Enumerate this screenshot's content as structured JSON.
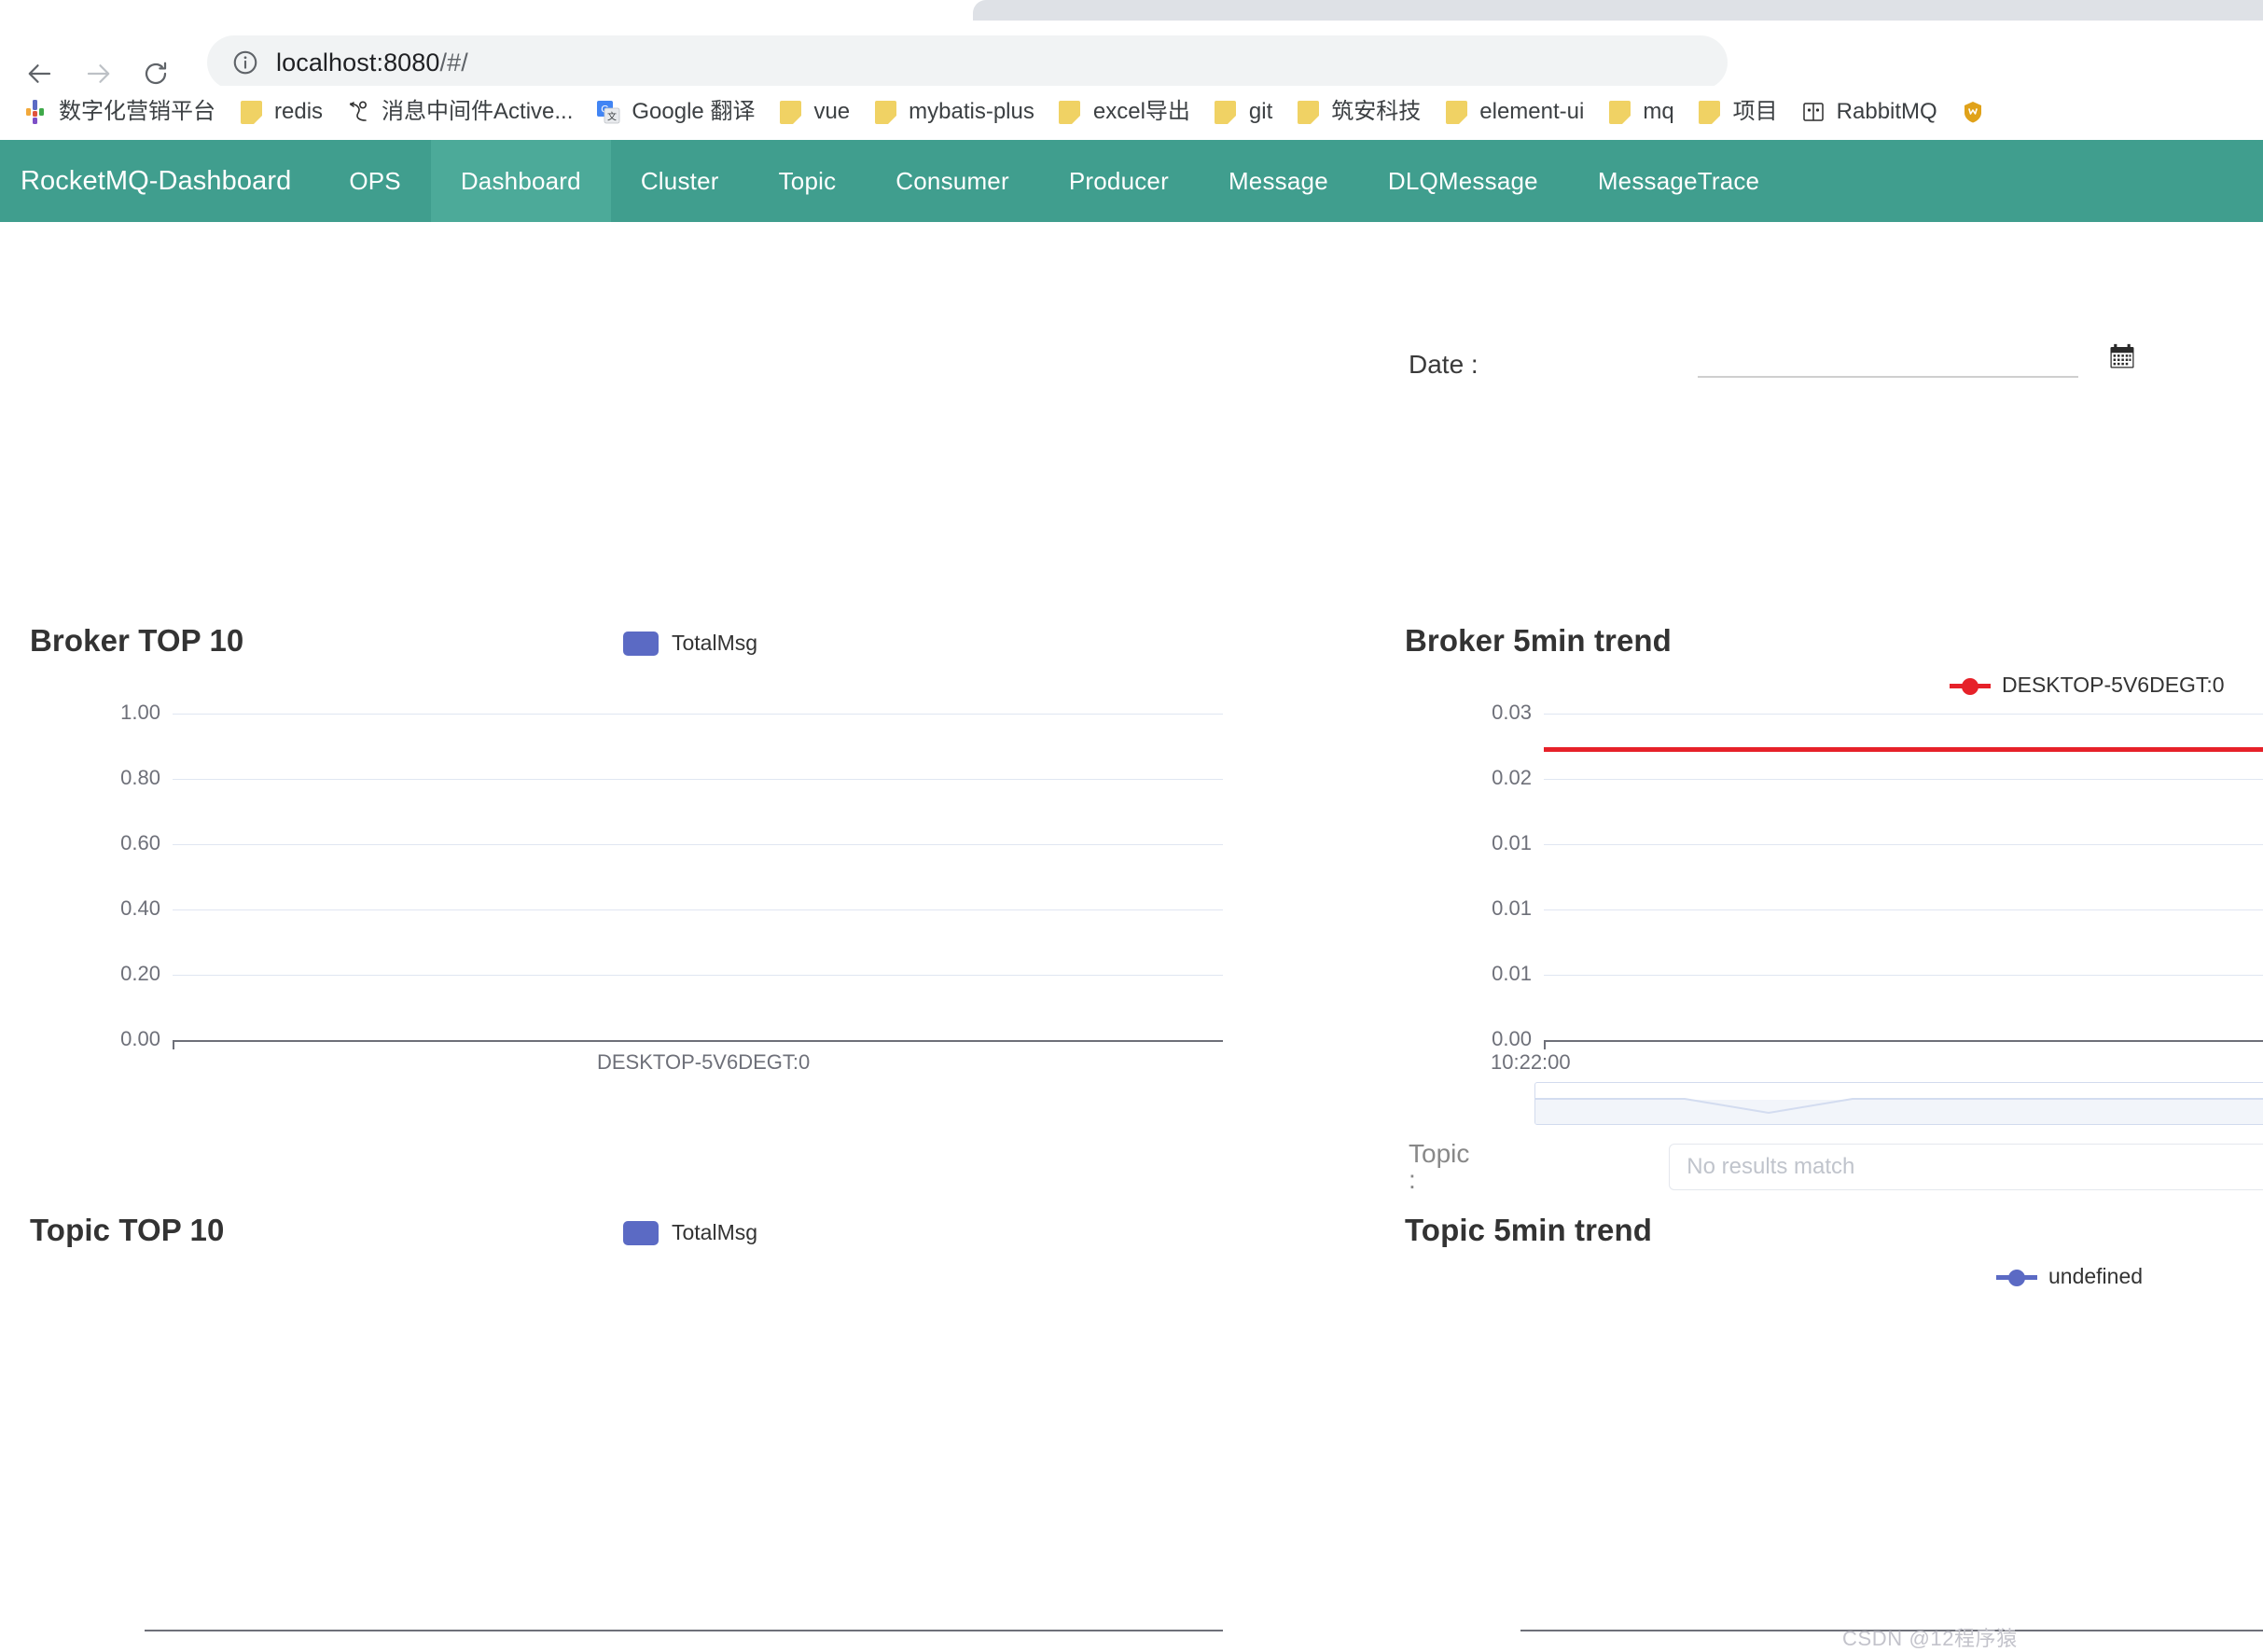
{
  "browser": {
    "url_host": "localhost:8080",
    "url_path": "/#/",
    "back_icon": "back-arrow-icon",
    "forward_icon": "forward-arrow-icon",
    "reload_icon": "reload-icon",
    "info_icon": "site-info-icon",
    "bookmarks": [
      {
        "label": "数字化营销平台",
        "icon": "app-logo-icon"
      },
      {
        "label": "redis",
        "icon": "folder-icon"
      },
      {
        "label": "消息中间件Active...",
        "icon": "activemq-icon"
      },
      {
        "label": "Google 翻译",
        "icon": "google-translate-icon"
      },
      {
        "label": "vue",
        "icon": "folder-icon"
      },
      {
        "label": "mybatis-plus",
        "icon": "folder-icon"
      },
      {
        "label": "excel导出",
        "icon": "folder-icon"
      },
      {
        "label": "git",
        "icon": "folder-icon"
      },
      {
        "label": "筑安科技",
        "icon": "folder-icon"
      },
      {
        "label": "element-ui",
        "icon": "folder-icon"
      },
      {
        "label": "mq",
        "icon": "folder-icon"
      },
      {
        "label": "项目",
        "icon": "folder-icon"
      },
      {
        "label": "RabbitMQ",
        "icon": "rabbitmq-icon"
      },
      {
        "label": "",
        "icon": "shield-bookmark-icon"
      }
    ]
  },
  "app": {
    "brand": "RocketMQ-Dashboard",
    "accent_color": "#409e8e",
    "accent_active_color": "#4caa99",
    "nav": [
      {
        "label": "OPS",
        "active": false
      },
      {
        "label": "Dashboard",
        "active": true
      },
      {
        "label": "Cluster",
        "active": false
      },
      {
        "label": "Topic",
        "active": false
      },
      {
        "label": "Consumer",
        "active": false
      },
      {
        "label": "Producer",
        "active": false
      },
      {
        "label": "Message",
        "active": false
      },
      {
        "label": "DLQMessage",
        "active": false
      },
      {
        "label": "MessageTrace",
        "active": false
      }
    ]
  },
  "filters": {
    "date_label": "Date :",
    "date_value": "",
    "date_placeholder": "",
    "calendar_icon": "calendar-icon",
    "topic_label": "Topic :",
    "topic_value": "",
    "topic_placeholder": "No results match"
  },
  "chart_data": [
    {
      "id": "broker-top-10",
      "type": "bar",
      "title": "Broker TOP 10",
      "legend": [
        "TotalMsg"
      ],
      "legend_position": "top-center",
      "legend_color": "#5b6ac4",
      "categories": [
        "DESKTOP-5V6DEGT:0"
      ],
      "values": [
        0
      ],
      "ytick_labels": [
        "1.00",
        "0.80",
        "0.60",
        "0.40",
        "0.20",
        "0.00"
      ],
      "ylim": [
        0,
        1
      ],
      "xlabel": "",
      "ylabel": "",
      "grid": true
    },
    {
      "id": "broker-5min-trend",
      "type": "line",
      "title": "Broker 5min trend",
      "legend": [
        "DESKTOP-5V6DEGT:0"
      ],
      "legend_position": "top-right",
      "legend_color": "#e62129",
      "series": [
        {
          "name": "DESKTOP-5V6DEGT:0",
          "values": [
            0.025,
            0.025,
            0.025,
            0.025,
            0.025
          ]
        }
      ],
      "x": [
        "10:22:00"
      ],
      "xtick_labels": [
        "10:22:00"
      ],
      "ytick_labels": [
        "0.03",
        "0.02",
        "0.01",
        "0.01",
        "0.01",
        "0.00"
      ],
      "ylim": [
        0,
        0.03
      ],
      "grid": true,
      "datazoom": true
    },
    {
      "id": "topic-top-10",
      "type": "bar",
      "title": "Topic TOP 10",
      "legend": [
        "TotalMsg"
      ],
      "legend_position": "top-center",
      "legend_color": "#5b6ac4",
      "categories": [],
      "values": [],
      "ytick_labels": [],
      "grid": false
    },
    {
      "id": "topic-5min-trend",
      "type": "line",
      "title": "Topic 5min trend",
      "legend": [
        "undefined"
      ],
      "legend_position": "top-right",
      "legend_color": "#5b6ac4",
      "series": [
        {
          "name": "undefined",
          "values": []
        }
      ],
      "x": [],
      "ytick_labels": [],
      "grid": false
    }
  ],
  "watermark": "CSDN @12程序猿"
}
